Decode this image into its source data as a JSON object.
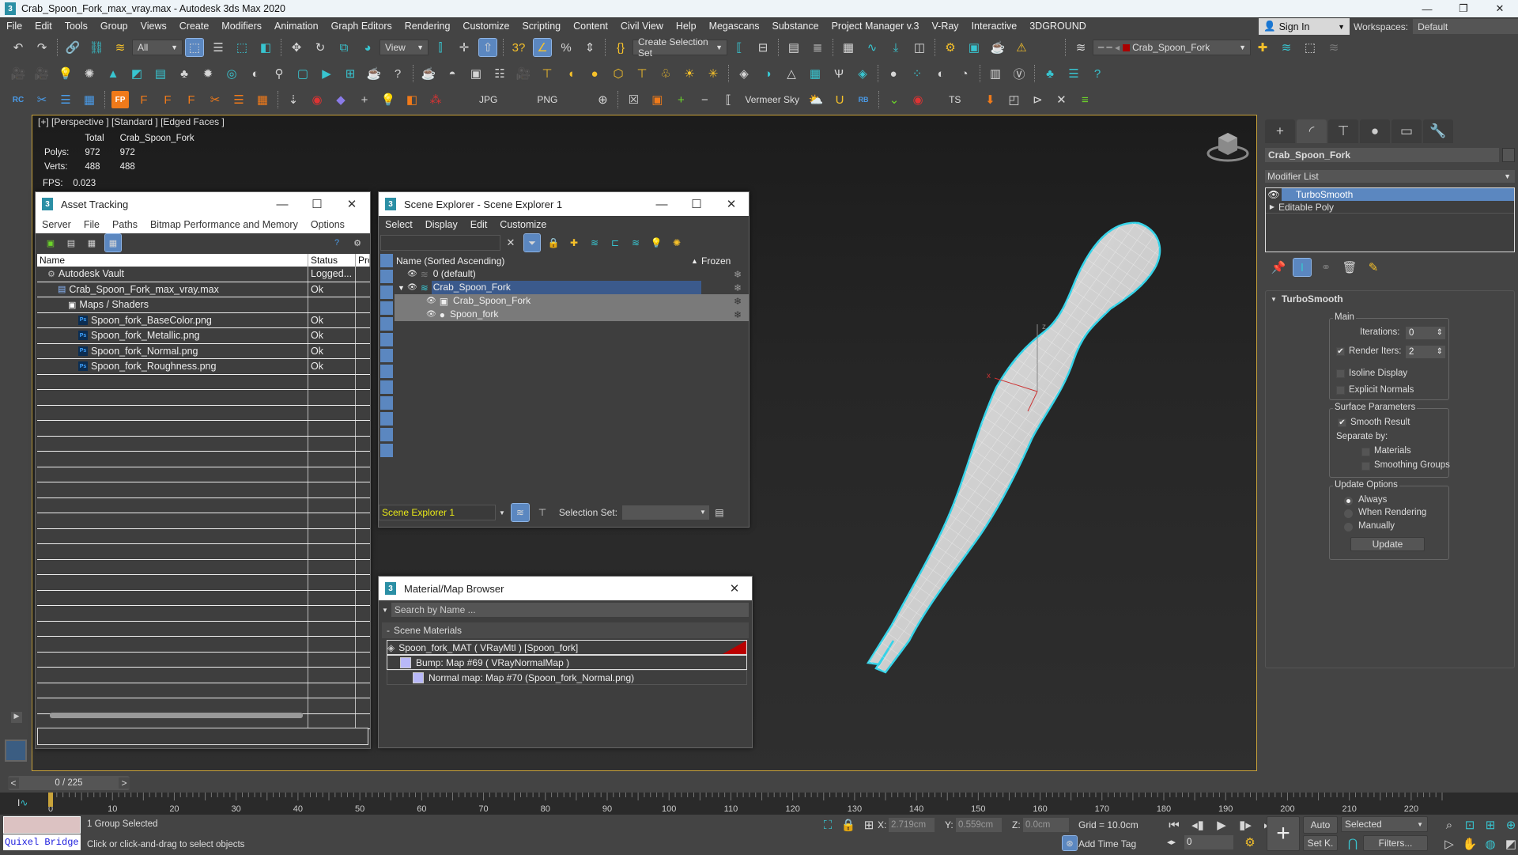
{
  "window": {
    "title": "Crab_Spoon_Fork_max_vray.max - Autodesk 3ds Max 2020",
    "app_icon": "3ds-max-logo-icon"
  },
  "menubar": {
    "items": [
      "File",
      "Edit",
      "Tools",
      "Group",
      "Views",
      "Create",
      "Modifiers",
      "Animation",
      "Graph Editors",
      "Rendering",
      "Customize",
      "Scripting",
      "Content",
      "Civil View",
      "Help",
      "Megascans",
      "Substance",
      "Project Manager v.3",
      "V-Ray",
      "Interactive",
      "3DGROUND"
    ],
    "sign_in": "Sign In",
    "workspaces_label": "Workspaces:",
    "workspace_value": "Default"
  },
  "main_toolbar": {
    "selection_filter": "All",
    "reference_coord": "View",
    "create_selection_set": "Create Selection Set",
    "layer_dropdown": "Crab_Spoon_Fork",
    "snap_number": "3"
  },
  "vray_toolbar": {
    "jpg_label": "JPG",
    "png_label": "PNG",
    "sky_label": "Vermeer Sky",
    "ts_label": "TS",
    "rc_label": "RC",
    "fp_label": "FP"
  },
  "viewport": {
    "label": "[+] [Perspective ]  [Standard ] [Edged Faces ]",
    "stats_headers": [
      "",
      "Total",
      "Crab_Spoon_Fork"
    ],
    "stats": [
      {
        "label": "Polys:",
        "total": "972",
        "object": "972"
      },
      {
        "label": "Verts:",
        "total": "488",
        "object": "488"
      }
    ],
    "fps_label": "FPS:",
    "fps_value": "0.023",
    "axis_x": "x",
    "axis_z": "z",
    "selection_color": "#35d3e8"
  },
  "asset_tracking": {
    "title": "Asset Tracking",
    "menu": [
      "Server",
      "File",
      "Paths",
      "Bitmap Performance and Memory",
      "Options"
    ],
    "columns": [
      "Name",
      "Status",
      "Pro"
    ],
    "rows": [
      {
        "name": "Autodesk Vault",
        "status": "Logged...",
        "indent": 1,
        "icon": "vault-icon"
      },
      {
        "name": "Crab_Spoon_Fork_max_vray.max",
        "status": "Ok",
        "indent": 2,
        "icon": "max-file-icon"
      },
      {
        "name": "Maps / Shaders",
        "status": "",
        "indent": 3,
        "icon": "maps-folder-icon"
      },
      {
        "name": "Spoon_fork_BaseColor.png",
        "status": "Ok",
        "indent": 4,
        "icon": "photoshop-file-icon"
      },
      {
        "name": "Spoon_fork_Metallic.png",
        "status": "Ok",
        "indent": 4,
        "icon": "photoshop-file-icon"
      },
      {
        "name": "Spoon_fork_Normal.png",
        "status": "Ok",
        "indent": 4,
        "icon": "photoshop-file-icon"
      },
      {
        "name": "Spoon_fork_Roughness.png",
        "status": "Ok",
        "indent": 4,
        "icon": "photoshop-file-icon"
      }
    ]
  },
  "scene_explorer": {
    "title": "Scene Explorer - Scene Explorer 1",
    "menu": [
      "Select",
      "Display",
      "Edit",
      "Customize"
    ],
    "search_value": "",
    "column_name": "Name (Sorted Ascending)",
    "column_frozen": "Frozen",
    "rows": [
      {
        "name": "0 (default)",
        "level": 0,
        "icon": "layer-icon",
        "selected": false,
        "expanded": false
      },
      {
        "name": "Crab_Spoon_Fork",
        "level": 0,
        "icon": "layer-icon",
        "selected": true,
        "expanded": true
      },
      {
        "name": "Crab_Spoon_Fork",
        "level": 1,
        "icon": "group-icon",
        "selected": false,
        "expanded": false
      },
      {
        "name": "Spoon_fork",
        "level": 1,
        "icon": "geometry-icon",
        "selected": false,
        "expanded": false
      }
    ],
    "explorer_name": "Scene Explorer 1",
    "selection_set_label": "Selection Set:",
    "selection_set_value": ""
  },
  "material_browser": {
    "title": "Material/Map Browser",
    "search_placeholder": "Search by Name ...",
    "section": "Scene Materials",
    "items": [
      {
        "label": "Spoon_fork_MAT  ( VRayMtl )  [Spoon_fork]",
        "level": 0
      },
      {
        "label": "Bump: Map #69  ( VRayNormalMap )",
        "level": 1
      },
      {
        "label": "Normal map: Map #70 (Spoon_fork_Normal.png)",
        "level": 2
      }
    ]
  },
  "command_panel": {
    "object_name": "Crab_Spoon_Fork",
    "modifier_list": "Modifier List",
    "stack": [
      {
        "name": "TurboSmooth",
        "selected": true
      },
      {
        "name": "Editable Poly",
        "selected": false
      }
    ],
    "rollout_title": "TurboSmooth",
    "main_group": "Main",
    "iterations_label": "Iterations:",
    "iterations_value": "0",
    "render_iters_label": "Render Iters:",
    "render_iters_value": "2",
    "render_iters_checked": true,
    "isoline_display": "Isoline Display",
    "isoline_checked": false,
    "explicit_normals": "Explicit Normals",
    "explicit_checked": false,
    "surface_group": "Surface Parameters",
    "smooth_result": "Smooth Result",
    "smooth_result_checked": true,
    "separate_by": "Separate by:",
    "materials": "Materials",
    "materials_checked": false,
    "smoothing_groups": "Smoothing Groups",
    "smoothing_checked": false,
    "update_group": "Update Options",
    "update_options": [
      "Always",
      "When Rendering",
      "Manually"
    ],
    "update_selected": "Always",
    "update_button": "Update"
  },
  "timeline": {
    "frame_display": "0 / 225",
    "current_frame": 0,
    "total_frames": 225,
    "ticks": [
      "0",
      "10",
      "20",
      "30",
      "40",
      "50",
      "60",
      "70",
      "80",
      "90",
      "100",
      "110",
      "120",
      "130",
      "140",
      "150",
      "160",
      "170",
      "180",
      "190",
      "200",
      "210",
      "220"
    ]
  },
  "status": {
    "quixel": "Quixel Bridge",
    "selection_status": "1 Group Selected",
    "prompt": "Click or click-and-drag to select objects",
    "x_label": "X:",
    "x_value": "2.719cm",
    "y_label": "Y:",
    "y_value": "0.559cm",
    "z_label": "Z:",
    "z_value": "0.0cm",
    "grid": "Grid = 10.0cm",
    "add_time_tag": "Add Time Tag",
    "frame_field": "0",
    "auto": "Auto",
    "set_key": "Set K.",
    "key_filter": "Selected",
    "filters": "Filters..."
  }
}
